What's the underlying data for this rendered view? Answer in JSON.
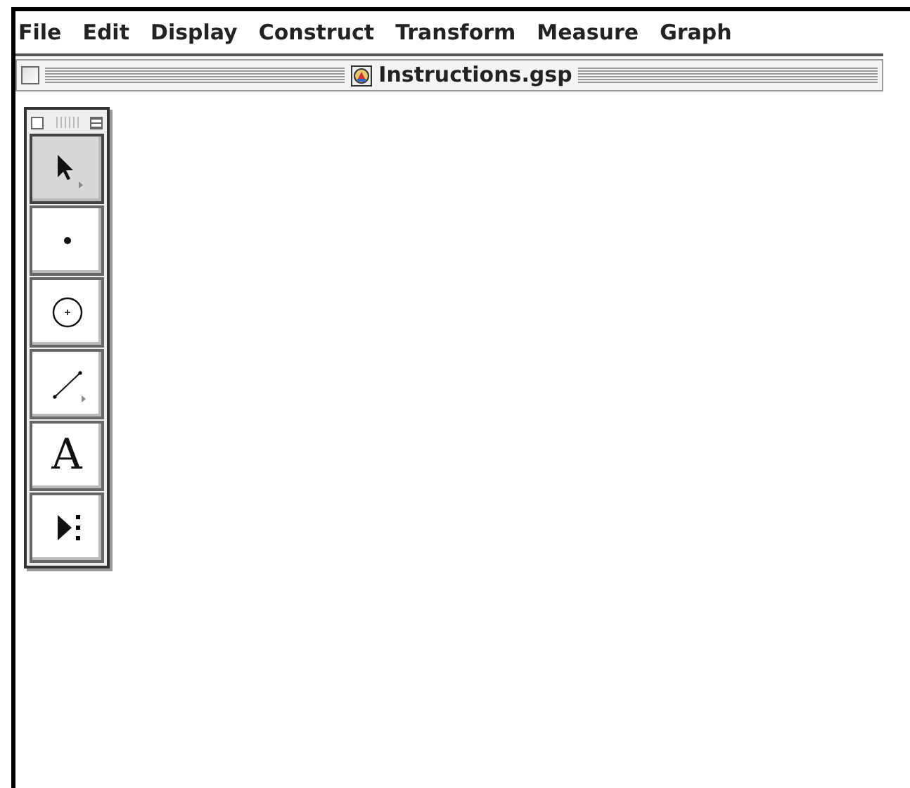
{
  "menu_bar": [
    "File",
    "Edit",
    "Display",
    "Construct",
    "Transform",
    "Measure",
    "Graph"
  ],
  "window": {
    "title": "Instructions.gsp"
  },
  "toolbox": {
    "tools": [
      {
        "kind": "arrow",
        "selected": true
      },
      {
        "kind": "point",
        "selected": false
      },
      {
        "kind": "compass",
        "selected": false
      },
      {
        "kind": "segment",
        "selected": false
      },
      {
        "kind": "text",
        "label": "A",
        "selected": false
      },
      {
        "kind": "script",
        "selected": false
      }
    ]
  }
}
